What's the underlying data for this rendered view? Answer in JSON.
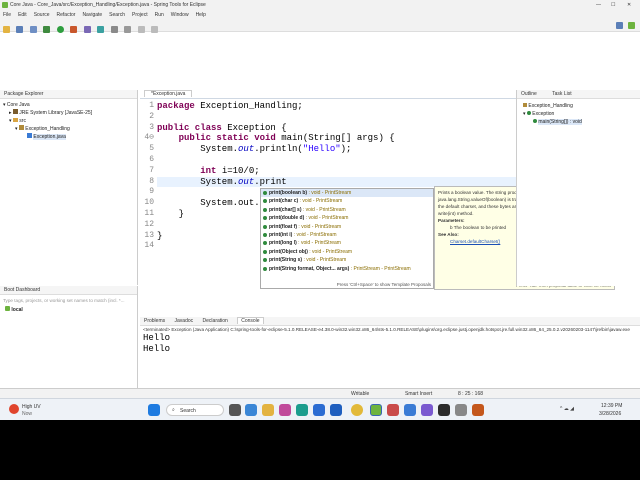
{
  "window": {
    "title": "Core Java - Core_Java/src/Exception_Handling/Exception.java - Spring Tools for Eclipse",
    "min": "—",
    "max": "☐",
    "close": "✕"
  },
  "menu": [
    "File",
    "Edit",
    "Source",
    "Refactor",
    "Navigate",
    "Search",
    "Project",
    "Run",
    "Window",
    "Help"
  ],
  "left_tabs": [
    "Package Explorer"
  ],
  "tree": [
    {
      "label": "Core Java",
      "indent": 0
    },
    {
      "label": "JRE System Library [JavaSE-25]",
      "indent": 1
    },
    {
      "label": "src",
      "indent": 1
    },
    {
      "label": "Exception_Handling",
      "indent": 2
    },
    {
      "label": "Exception.java",
      "indent": 3
    }
  ],
  "editor": {
    "tab": "*Exception.java",
    "lines": [
      {
        "n": "1",
        "html": "<span class=\"kw\">package</span> Exception_Handling;"
      },
      {
        "n": "2",
        "html": ""
      },
      {
        "n": "3",
        "html": "<span class=\"kw\">public class</span> Exception {"
      },
      {
        "n": "4⊖",
        "html": "    <span class=\"kw\">public static void</span> main(String[] args) {"
      },
      {
        "n": "5",
        "html": "        System.<span class=\"fld\">out</span>.println(<span class=\"str\">\"Hello\"</span>);"
      },
      {
        "n": "6",
        "html": ""
      },
      {
        "n": "7",
        "html": "        <span class=\"kw\">int</span> i=10/0;"
      },
      {
        "n": "8",
        "html": "        System.<span class=\"fld\">out</span>.print"
      },
      {
        "n": "9",
        "html": ""
      },
      {
        "n": "10",
        "html": "        System.out.p"
      },
      {
        "n": "11",
        "html": "    }"
      },
      {
        "n": "12",
        "html": ""
      },
      {
        "n": "13",
        "html": "}"
      },
      {
        "n": "14",
        "html": ""
      }
    ]
  },
  "completion": {
    "items": [
      {
        "sig": "print(boolean b)",
        "ret": ": void - PrintStream"
      },
      {
        "sig": "print(char c)",
        "ret": ": void - PrintStream"
      },
      {
        "sig": "print(char[] s)",
        "ret": ": void - PrintStream"
      },
      {
        "sig": "print(double d)",
        "ret": ": void - PrintStream"
      },
      {
        "sig": "print(float f)",
        "ret": ": void - PrintStream"
      },
      {
        "sig": "print(int i)",
        "ret": ": void - PrintStream"
      },
      {
        "sig": "print(long l)",
        "ret": ": void - PrintStream"
      },
      {
        "sig": "print(Object obj)",
        "ret": ": void - PrintStream"
      },
      {
        "sig": "print(String s)",
        "ret": ": void - PrintStream"
      },
      {
        "sig": "print(String format, Object... args)",
        "ret": ": PrintStream - PrintStream"
      }
    ],
    "footer": "Press 'Ctrl+Space' to show Template Proposals"
  },
  "doc": {
    "text1": "Prints a boolean value. The string produced by",
    "text2": "java.lang.String.valueOf(boolean) is translated into bytes according to",
    "text3": "the default charset, and these bytes are written in exactly the manner of the",
    "text4": "write(int) method.",
    "params_h": "Parameters:",
    "param": "b The boolean to be printed",
    "see_h": "See Also:",
    "see": "Charset.defaultCharset()",
    "footer": "Press 'Tab' from proposal table or click for focus"
  },
  "outline": {
    "tabs": [
      "Outline",
      "Task List"
    ],
    "items": [
      "Exception_Handling",
      "Exception",
      "main(String[]) : void"
    ]
  },
  "boot": {
    "tab": "Boot Dashboard",
    "filter_placeholder": "Type tags, projects, or working set names to match (incl. *...",
    "local": "local"
  },
  "console": {
    "tabs": [
      "Problems",
      "Javadoc",
      "Declaration",
      "Console"
    ],
    "header": "<terminated> Exception (Java Application) C:\\spring-tools-for-eclipse-5.1.0.RELEASE-e4.38.0-win32.win32.x86_64\\sts-5.1.0.RELEASE\\plugins\\org.eclipse.justj.openjdk.hotspot.jre.full.win32.x86_64_25.0.2.v20260203-1147\\jre\\bin\\javaw.exe",
    "output": [
      "Hello",
      "Hello"
    ]
  },
  "status": {
    "writable": "Writable",
    "insert": "Smart Insert",
    "position": "8 : 25 : 168"
  },
  "taskbar": {
    "weather_title": "High UV",
    "weather_sub": "Now",
    "search": "Search",
    "time": "12:39 PM",
    "date": "3/28/2026"
  }
}
